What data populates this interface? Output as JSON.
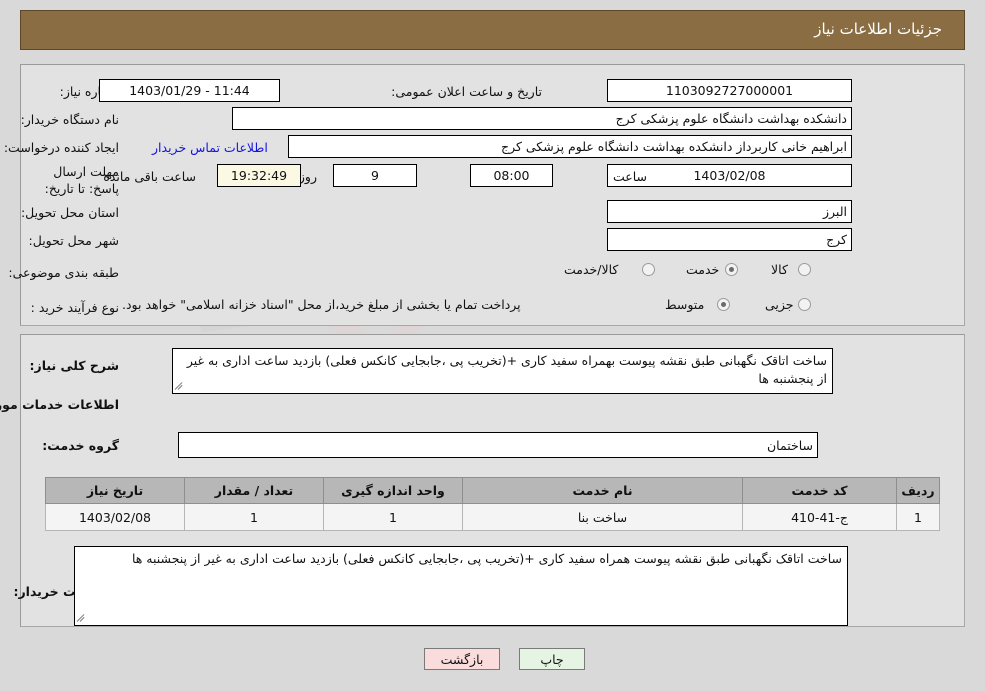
{
  "header": {
    "title": "جزئیات اطلاعات نیاز",
    "bar_color": "#8a6d43"
  },
  "watermark": {
    "text": "AriaTender.net"
  },
  "top_panel": {
    "need_number_label": "شماره نیاز:",
    "need_number_value": "1103092727000001",
    "announce_datetime_label": "تاریخ و ساعت اعلان عمومی:",
    "announce_datetime_value": "1403/01/29 - 11:44",
    "buyer_org_label": "نام دستگاه خریدار:",
    "buyer_org_value": "دانشکده بهداشت دانشگاه علوم پزشکی کرج",
    "requester_label": "ایجاد کننده درخواست:",
    "requester_value": "ابراهیم خانی کاربرداز دانشکده بهداشت دانشگاه علوم پزشکی کرج",
    "contact_link": "اطلاعات تماس خریدار",
    "deadline_label": "مهلت ارسال پاسخ: تا تاریخ:",
    "deadline_date": "1403/02/08",
    "deadline_hour_label": "ساعت",
    "deadline_hour_value": "08:00",
    "days_value": "9",
    "days_label": "روز و",
    "countdown_value": "19:32:49",
    "countdown_label": "ساعت باقی مانده",
    "province_label": "استان محل تحویل:",
    "province_value": "البرز",
    "city_label": "شهر محل تحویل:",
    "city_value": "کرج",
    "category_label": "طبقه بندی موضوعی:",
    "category_options": [
      {
        "label": "کالا",
        "selected": false
      },
      {
        "label": "خدمت",
        "selected": true
      },
      {
        "label": "کالا/خدمت",
        "selected": false
      }
    ],
    "process_label": "نوع فرآیند خرید :",
    "process_options": [
      {
        "label": "جزیی",
        "selected": false
      },
      {
        "label": "متوسط",
        "selected": true
      }
    ],
    "payment_note": "پرداخت تمام یا بخشی از مبلغ خرید،از محل \"اسناد خزانه اسلامی\" خواهد بود."
  },
  "mid_panel": {
    "need_desc_label": "شرح کلی نیاز:",
    "need_desc_value": "ساخت اتاقک نگهبانی طبق نقشه پیوست بهمراه سفید کاری  +(تخریب پی ،جابجایی کانکس فعلی) بازدید ساعت اداری به غیر از پنجشنبه ها",
    "services_heading": "اطلاعات خدمات مورد نیاز",
    "service_group_label": "گروه خدمت:",
    "service_group_value": "ساختمان",
    "table": {
      "columns": [
        "ردیف",
        "کد خدمت",
        "نام خدمت",
        "واحد اندازه گیری",
        "تعداد / مقدار",
        "تاریخ نیاز"
      ],
      "rows": [
        [
          "1",
          "ج-41-410",
          "ساخت بنا",
          "1",
          "1",
          "1403/02/08"
        ]
      ]
    },
    "buyer_notes_label": "توضیحات خریدار:",
    "buyer_notes_value": "ساخت اتاقک نگهبانی طبق نقشه پیوست همراه سفید کاری +(تخریب پی ،جابجایی کانکس فعلی) بازدید ساعت اداری به غیر از پنجشنبه ها"
  },
  "footer": {
    "print_label": "چاپ",
    "back_label": "بازگشت"
  }
}
